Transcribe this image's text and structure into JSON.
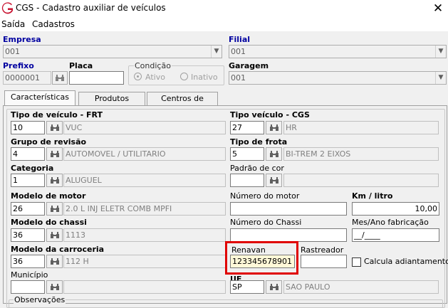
{
  "window": {
    "title": "CGS - Cadastro auxiliar de veículos",
    "close_glyph": "✕",
    "icon": "app-logo-icon"
  },
  "menu": {
    "items": [
      "Saída",
      "Cadastros"
    ]
  },
  "header": {
    "empresa": {
      "label": "Empresa",
      "value": "001"
    },
    "filial": {
      "label": "Filial",
      "value": "001"
    },
    "prefixo": {
      "label": "Prefixo",
      "value": "0000001"
    },
    "placa": {
      "label": "Placa",
      "value": ""
    },
    "condicao": {
      "label": "Condição",
      "options": [
        "Ativo",
        "Inativo"
      ],
      "selected": "Ativo"
    },
    "garagem": {
      "label": "Garagem",
      "value": "001"
    }
  },
  "tabs": [
    {
      "label": "Características",
      "active": true
    },
    {
      "label": "Produtos",
      "active": false
    },
    {
      "label": "Centros de custos",
      "active": false
    }
  ],
  "form": {
    "tipo_veiculo_frt": {
      "label": "Tipo de veículo - FRT",
      "code": "10",
      "desc": "VUC"
    },
    "tipo_veiculo_cgs": {
      "label": "Tipo veículo - CGS",
      "code": "27",
      "desc": "HR"
    },
    "grupo_revisao": {
      "label": "Grupo de revisão",
      "code": "4",
      "desc": "AUTOMOVEL / UTILITARIO"
    },
    "tipo_frota": {
      "label": "Tipo de frota",
      "code": "5",
      "desc": "BI-TREM 2 EIXOS"
    },
    "categoria": {
      "label": "Categoria",
      "code": "1",
      "desc": "ALUGUEL"
    },
    "padrao_cor": {
      "label": "Padrão de cor",
      "code": "",
      "desc": ""
    },
    "modelo_motor": {
      "label": "Modelo de motor",
      "code": "26",
      "desc": "2.0 L INJ ELETR COMB MPFI"
    },
    "numero_motor": {
      "label": "Número do motor",
      "value": ""
    },
    "km_litro": {
      "label": "Km / litro",
      "value": "10,00"
    },
    "modelo_chassi": {
      "label": "Modelo do chassi",
      "code": "36",
      "desc": "1113"
    },
    "numero_chassi": {
      "label": "Número do Chassi",
      "value": ""
    },
    "mes_ano_fabricacao": {
      "label": "Mes/Ano fabricação",
      "value": "__/____"
    },
    "modelo_carroceria": {
      "label": "Modelo da carroceria",
      "code": "36",
      "desc": "112 H"
    },
    "renavan": {
      "label": "Renavan",
      "value": "123345678901"
    },
    "rastreador": {
      "label": "Rastreador",
      "value": ""
    },
    "calcula_adiantamento": {
      "label": "Calcula adiantamento",
      "checked": false
    },
    "municipio": {
      "label": "Município",
      "code": "",
      "desc": ""
    },
    "uf": {
      "label": "UF",
      "code": "SP",
      "desc": "SAO PAULO"
    },
    "observacoes": {
      "label": "Observações"
    }
  },
  "colors": {
    "label_blue": "#0000a0",
    "highlight_red": "#e00000",
    "logo_red": "#c8102e"
  }
}
